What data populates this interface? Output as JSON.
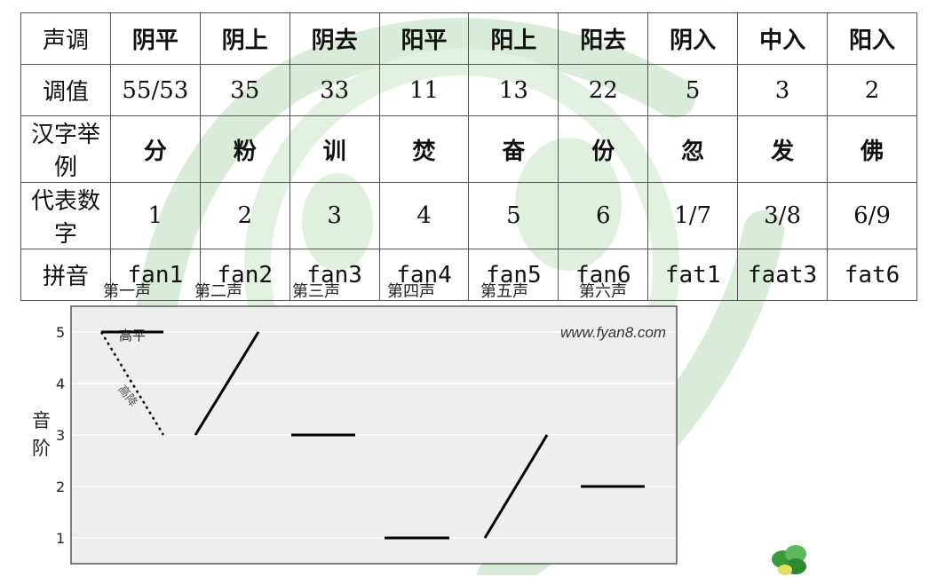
{
  "table": {
    "header_labels": [
      "声调",
      "调值",
      "汉字举例",
      "代表数字",
      "拼音"
    ],
    "tone_names": [
      "阴平",
      "阴上",
      "阴去",
      "阳平",
      "阳上",
      "阳去",
      "阴入",
      "中入",
      "阳入"
    ],
    "tone_values": [
      "55/53",
      "35",
      "33",
      "11",
      "13",
      "22",
      "5",
      "3",
      "2"
    ],
    "example_chars": [
      "分",
      "粉",
      "训",
      "焚",
      "奋",
      "份",
      "忽",
      "发",
      "佛"
    ],
    "digits": [
      "1",
      "2",
      "3",
      "4",
      "5",
      "6",
      "1/7",
      "3/8",
      "6/9"
    ],
    "pinyin": [
      "fan1",
      "fan2",
      "fan3",
      "fan4",
      "fan5",
      "fan6",
      "fat1",
      "faat3",
      "fat6"
    ]
  },
  "chart": {
    "tone_labels": [
      "第一声",
      "第二声",
      "第三声",
      "第四声",
      "第五声",
      "第六声"
    ],
    "y_axis_label_1": "音",
    "y_axis_label_2": "阶",
    "website": "www.fyan8.com",
    "annotation_high": "高平",
    "annotation_fall": "高降"
  },
  "chart_data": {
    "type": "line",
    "ylim": [
      0.5,
      5.5
    ],
    "yticks": [
      "1",
      "2",
      "3",
      "4",
      "5"
    ],
    "grid": true,
    "segments": [
      {
        "tone": "第一声",
        "from": 5,
        "to": 5
      },
      {
        "tone": "第一声",
        "from": 5,
        "to": 3,
        "style": "dotted"
      },
      {
        "tone": "第二声",
        "from": 3,
        "to": 5
      },
      {
        "tone": "第三声",
        "from": 3,
        "to": 3
      },
      {
        "tone": "第四声",
        "from": 1,
        "to": 1
      },
      {
        "tone": "第五声",
        "from": 1,
        "to": 3
      },
      {
        "tone": "第六声",
        "from": 2,
        "to": 2
      }
    ]
  },
  "colors": {
    "watermark": "#d6ead6",
    "plot_bg": "#eeeeee",
    "grid": "#ffffff",
    "line": "#000000"
  }
}
